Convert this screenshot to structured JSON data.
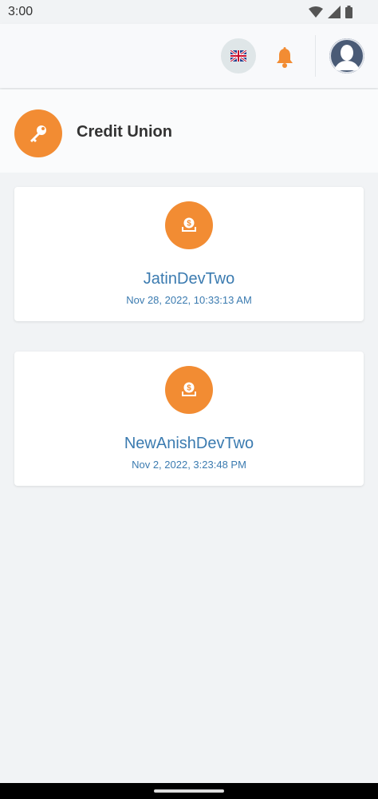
{
  "status_bar": {
    "time": "3:00"
  },
  "header": {
    "language": "English (UK)"
  },
  "section": {
    "title": "Credit Union"
  },
  "cards": [
    {
      "title": "JatinDevTwo",
      "date": "Nov 28, 2022, 10:33:13 AM"
    },
    {
      "title": "NewAnishDevTwo",
      "date": "Nov 2, 2022, 3:23:48 PM"
    }
  ],
  "colors": {
    "accent": "#f28c33",
    "link": "#3b7bb0",
    "background": "#f1f3f5",
    "avatar": "#4a5b76"
  }
}
